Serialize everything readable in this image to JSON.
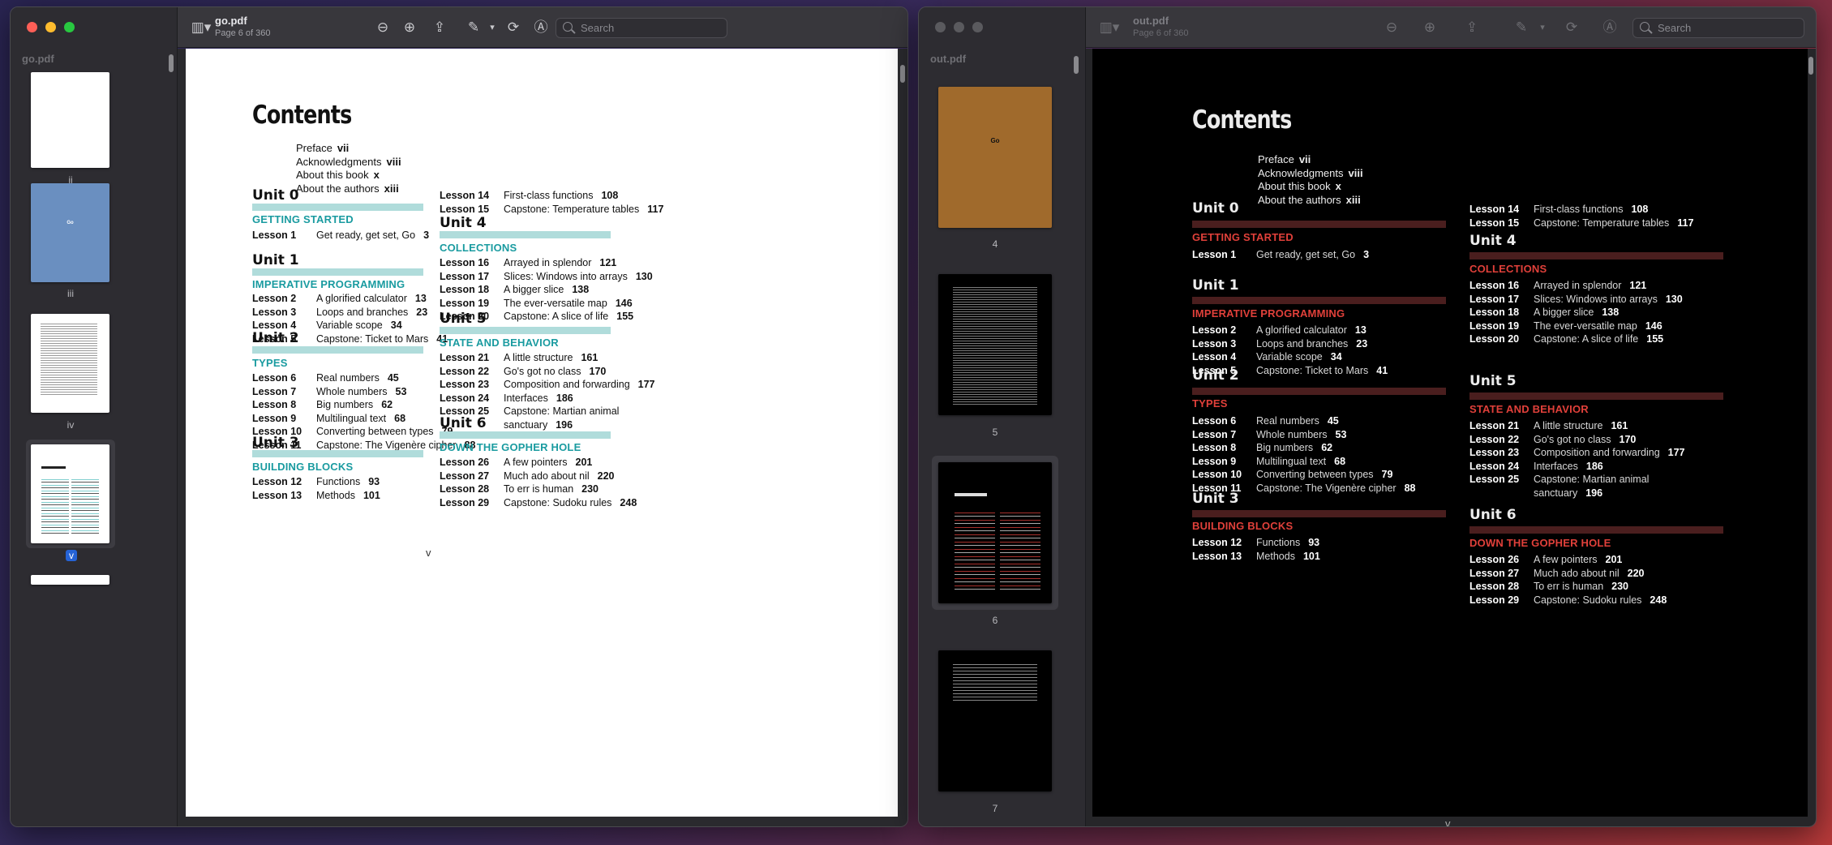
{
  "left_window": {
    "doc_title": "go.pdf",
    "page_info": "Page 6 of 360",
    "search_placeholder": "Search",
    "sidebar_title": "go.pdf",
    "thumbnails": [
      {
        "label": "ii"
      },
      {
        "label": "iii",
        "cover_title": "Go"
      },
      {
        "label": "iv"
      },
      {
        "label": "v",
        "selected": true
      },
      {
        "label": ""
      }
    ],
    "colors": {
      "bar": "#b0dcdb",
      "subhead": "#1a9ba0"
    }
  },
  "right_window": {
    "doc_title": "out.pdf",
    "page_info": "Page 6 of 360",
    "search_placeholder": "Search",
    "sidebar_title": "out.pdf",
    "thumbnails": [
      {
        "label": "4",
        "cover_title": "Go"
      },
      {
        "label": "5"
      },
      {
        "label": "6",
        "selected": true
      },
      {
        "label": "7"
      }
    ],
    "colors": {
      "bar": "#4a1e1e",
      "subhead": "#e0403a"
    }
  },
  "contents": {
    "title": "Contents",
    "front_matter": [
      {
        "label": "Preface",
        "page": "vii"
      },
      {
        "label": "Acknowledgments",
        "page": "viii"
      },
      {
        "label": "About this book",
        "page": "x"
      },
      {
        "label": "About the authors",
        "page": "xiii"
      }
    ],
    "units_left": [
      {
        "unit": "Unit 0",
        "subtitle": "GETTING STARTED",
        "lessons": [
          {
            "n": "Lesson 1",
            "t": "Get ready, get set, Go",
            "p": "3"
          }
        ]
      },
      {
        "unit": "Unit 1",
        "subtitle": "IMPERATIVE PROGRAMMING",
        "lessons": [
          {
            "n": "Lesson 2",
            "t": "A glorified calculator",
            "p": "13"
          },
          {
            "n": "Lesson 3",
            "t": "Loops and branches",
            "p": "23"
          },
          {
            "n": "Lesson 4",
            "t": "Variable scope",
            "p": "34"
          },
          {
            "n": "Lesson 5",
            "t": "Capstone: Ticket to Mars",
            "p": "41"
          }
        ]
      },
      {
        "unit": "Unit 2",
        "subtitle": "TYPES",
        "lessons": [
          {
            "n": "Lesson 6",
            "t": "Real numbers",
            "p": "45"
          },
          {
            "n": "Lesson 7",
            "t": "Whole numbers",
            "p": "53"
          },
          {
            "n": "Lesson 8",
            "t": "Big numbers",
            "p": "62"
          },
          {
            "n": "Lesson 9",
            "t": "Multilingual text",
            "p": "68"
          },
          {
            "n": "Lesson 10",
            "t": "Converting between types",
            "p": "79"
          },
          {
            "n": "Lesson 11",
            "t": "Capstone: The Vigenère cipher",
            "p": "88"
          }
        ]
      },
      {
        "unit": "Unit 3",
        "subtitle": "BUILDING BLOCKS",
        "lessons": [
          {
            "n": "Lesson 12",
            "t": "Functions",
            "p": "93"
          },
          {
            "n": "Lesson 13",
            "t": "Methods",
            "p": "101"
          }
        ]
      }
    ],
    "top_right_lessons": [
      {
        "n": "Lesson 14",
        "t": "First-class functions",
        "p": "108"
      },
      {
        "n": "Lesson 15",
        "t": "Capstone: Temperature tables",
        "p": "117"
      }
    ],
    "units_right": [
      {
        "unit": "Unit 4",
        "subtitle": "COLLECTIONS",
        "lessons": [
          {
            "n": "Lesson 16",
            "t": "Arrayed in splendor",
            "p": "121"
          },
          {
            "n": "Lesson 17",
            "t": "Slices: Windows into arrays",
            "p": "130"
          },
          {
            "n": "Lesson 18",
            "t": "A bigger slice",
            "p": "138"
          },
          {
            "n": "Lesson 19",
            "t": "The ever-versatile map",
            "p": "146"
          },
          {
            "n": "Lesson 20",
            "t": "Capstone: A slice of life",
            "p": "155"
          }
        ]
      },
      {
        "unit": "Unit 5",
        "subtitle": "STATE AND BEHAVIOR",
        "lessons": [
          {
            "n": "Lesson 21",
            "t": "A little structure",
            "p": "161"
          },
          {
            "n": "Lesson 22",
            "t": "Go's got no class",
            "p": "170"
          },
          {
            "n": "Lesson 23",
            "t": "Composition and forwarding",
            "p": "177"
          },
          {
            "n": "Lesson 24",
            "t": "Interfaces",
            "p": "186"
          },
          {
            "n": "Lesson 25",
            "t": "Capstone: Martian animal",
            "t2": "sanctuary",
            "p": "196"
          }
        ]
      },
      {
        "unit": "Unit 6",
        "subtitle": "DOWN THE GOPHER HOLE",
        "lessons": [
          {
            "n": "Lesson 26",
            "t": "A few pointers",
            "p": "201"
          },
          {
            "n": "Lesson 27",
            "t": "Much ado about nil",
            "p": "220"
          },
          {
            "n": "Lesson 28",
            "t": "To err is human",
            "p": "230"
          },
          {
            "n": "Lesson 29",
            "t": "Capstone: Sudoku rules",
            "p": "248"
          }
        ]
      }
    ],
    "page_number": "v"
  }
}
